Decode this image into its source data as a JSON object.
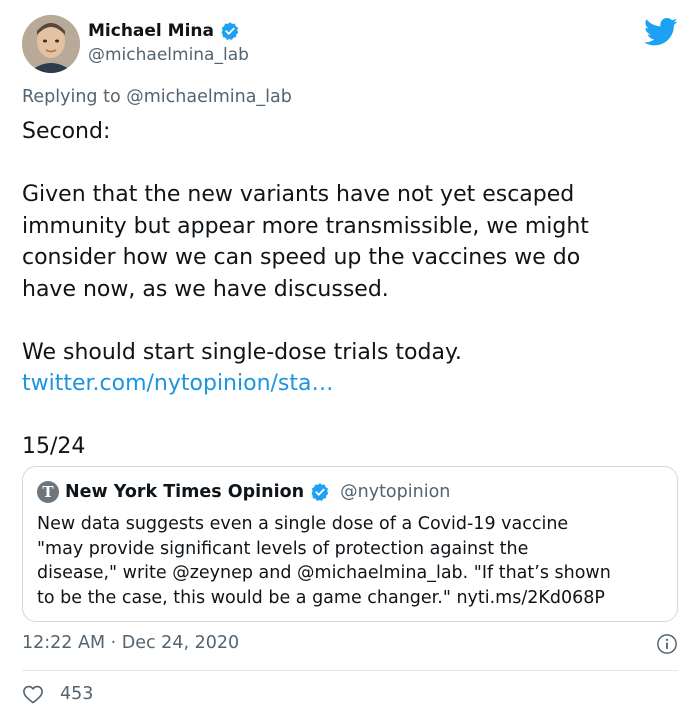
{
  "author": {
    "name": "Michael Mina",
    "handle": "@michaelmina_lab",
    "verified": true
  },
  "reply": {
    "prefix": "Replying to ",
    "mention": "@michaelmina_lab"
  },
  "tweet": {
    "lines": [
      "Second:",
      "",
      "Given that the new variants have not yet escaped",
      "immunity but appear more transmissible, we might",
      "consider how we can speed up the vaccines we do",
      "have now, as we have discussed.",
      "",
      "We should start single-dose trials today."
    ],
    "link": "twitter.com/nytopinion/sta…",
    "counter": "15/24"
  },
  "quote": {
    "logo_letter": "T",
    "name": "New York Times Opinion",
    "handle": "@nytopinion",
    "lines": [
      "New data suggests even a single dose of a Covid-19 vaccine",
      "\"may provide significant levels of protection against the",
      "disease,\" write @zeynep and @michaelmina_lab. \"If that’s shown",
      "to be the case, this would be a game changer.\" nyti.ms/2Kd068P"
    ]
  },
  "meta": {
    "timestamp": "12:22 AM · Dec 24, 2020",
    "likes": "453"
  },
  "colors": {
    "brand_blue": "#1da1f2",
    "link_blue": "#1b95e0",
    "secondary_text": "#536471",
    "border": "#cfd9de"
  },
  "icons": {
    "logo": "twitter-bird-icon",
    "verified": "verified-badge-icon",
    "info": "info-icon",
    "like": "heart-icon"
  }
}
